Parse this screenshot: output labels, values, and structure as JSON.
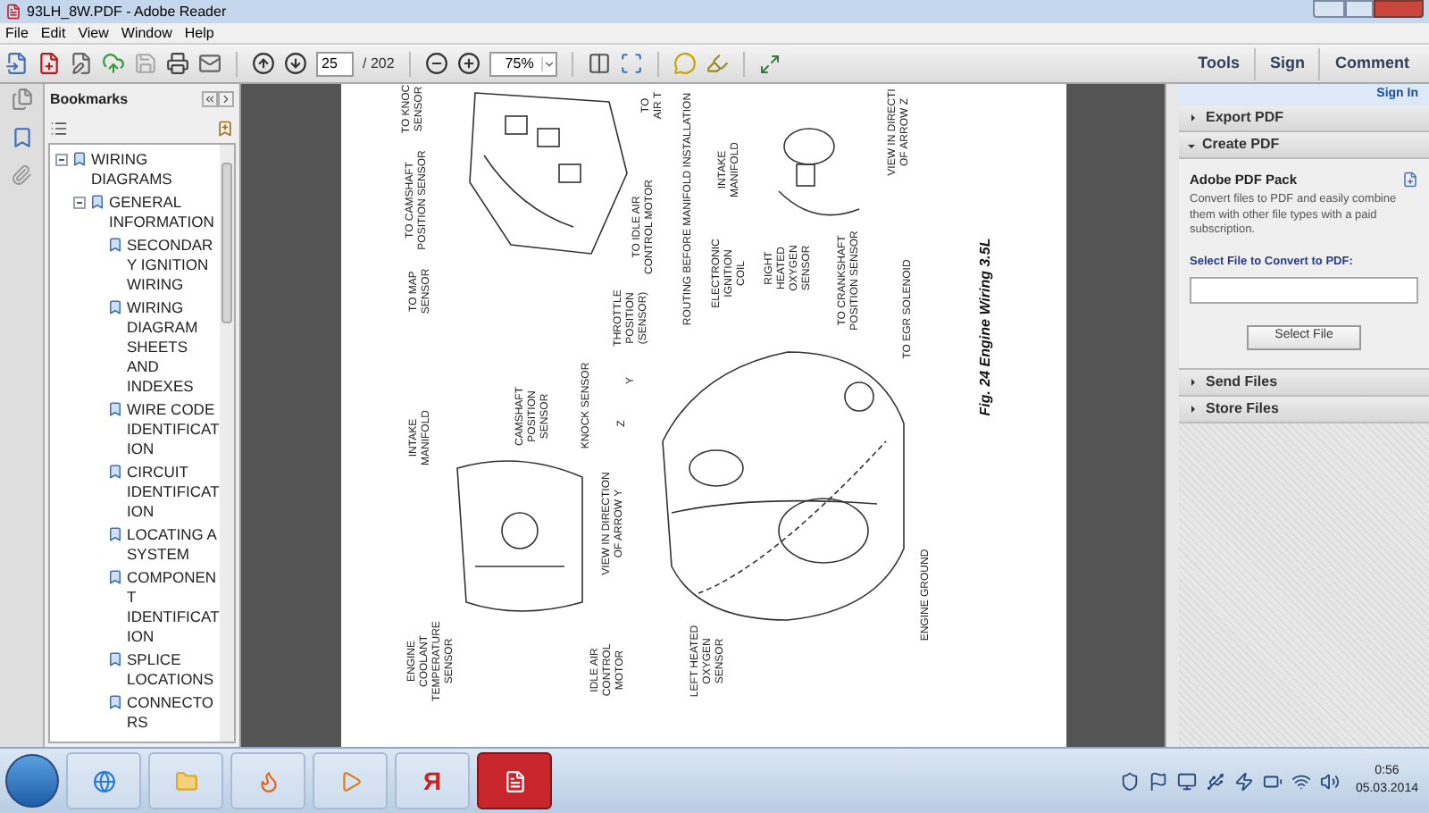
{
  "window": {
    "title": "93LH_8W.PDF - Adobe Reader"
  },
  "menu": [
    "File",
    "Edit",
    "View",
    "Window",
    "Help"
  ],
  "toolbar": {
    "page": "25",
    "page_count": "/ 202",
    "zoom": "75%",
    "right_buttons": [
      "Tools",
      "Sign",
      "Comment"
    ]
  },
  "bookmarks": {
    "title": "Bookmarks",
    "tree": [
      {
        "label": "WIRING DIAGRAMS",
        "expanded": true,
        "children": [
          {
            "label": "GENERAL INFORMATION",
            "expanded": true,
            "children": [
              {
                "label": "SECONDARY IGNITION WIRING"
              },
              {
                "label": "WIRING DIAGRAM SHEETS AND INDEXES"
              },
              {
                "label": "WIRE CODE IDENTIFICATION"
              },
              {
                "label": "CIRCUIT IDENTIFICATION"
              },
              {
                "label": "LOCATING A SYSTEM"
              },
              {
                "label": "COMPONENT IDENTIFICATION"
              },
              {
                "label": "SPLICE LOCATIONS"
              },
              {
                "label": "CONNECTORS"
              }
            ]
          }
        ]
      }
    ]
  },
  "document": {
    "labels": [
      {
        "text": "TO KNOC\nSENSOR"
      },
      {
        "text": "TO CAMSHAFT\nPOSITION SENSOR"
      },
      {
        "text": "TO MAP\nSENSOR"
      },
      {
        "text": "TO IDLE AIR\nCONTROL MOTOR"
      },
      {
        "text": "ROUTING BEFORE MANIFOLD INSTALLATION"
      },
      {
        "text": "TO\nAIR T"
      },
      {
        "text": "INTAKE\nMANIFOLD"
      },
      {
        "text": "VIEW IN DIRECTI\nOF ARROW Z"
      },
      {
        "text": "THROTTLE\nPOSITION\n(SENSOR)"
      },
      {
        "text": "ELECTRONIC\nIGNITION\nCOIL"
      },
      {
        "text": "RIGHT\nHEATED\nOXYGEN\nSENSOR"
      },
      {
        "text": "TO CRANKSHAFT\nPOSITION SENSOR"
      },
      {
        "text": "TO EGR SOLENOID"
      },
      {
        "text": "INTAKE\nMANIFOLD"
      },
      {
        "text": "CAMSHAFT\nPOSITION\nSENSOR"
      },
      {
        "text": "KNOCK SENSOR"
      },
      {
        "text": "VIEW IN DIRECTION\nOF ARROW Y"
      },
      {
        "text": "ENGINE\nCOOLANT\nTEMPERATURE\nSENSOR"
      },
      {
        "text": "IDLE AIR\nCONTROL\nMOTOR"
      },
      {
        "text": "LEFT HEATED\nOXYGEN\nSENSOR"
      },
      {
        "text": "ENGINE GROUND"
      },
      {
        "text": "Y"
      },
      {
        "text": "Z"
      }
    ],
    "caption": "Fig. 24 Engine Wiring 3.5L"
  },
  "right_panel": {
    "sign_in": "Sign In",
    "sections": [
      {
        "title": "Export PDF",
        "expanded": false
      },
      {
        "title": "Create PDF",
        "expanded": true,
        "heading": "Adobe PDF Pack",
        "description": "Convert files to PDF and easily combine them with other file types with a paid subscription.",
        "field_label": "Select File to Convert to PDF:",
        "button": "Select File"
      },
      {
        "title": "Send Files",
        "expanded": false
      },
      {
        "title": "Store Files",
        "expanded": false
      }
    ]
  },
  "taskbar": {
    "apps": [
      {
        "kind": "browser",
        "selected": false
      },
      {
        "kind": "folder",
        "selected": false
      },
      {
        "kind": "firefox",
        "selected": false
      },
      {
        "kind": "media",
        "selected": false
      },
      {
        "kind": "yandex",
        "label": "Я",
        "selected": false
      },
      {
        "kind": "reader",
        "selected": true
      }
    ],
    "time": "0:56",
    "date": "05.03.2014"
  }
}
